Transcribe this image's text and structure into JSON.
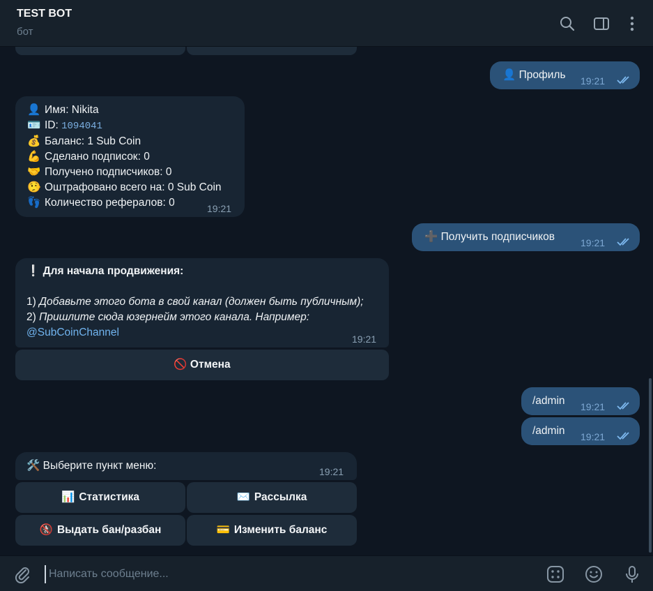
{
  "header": {
    "title": "TEST BOT",
    "subtitle": "бот"
  },
  "messages": {
    "profile_out": {
      "text": "👤 Профиль",
      "time": "19:21"
    },
    "profile_in": {
      "lines": [
        {
          "emoji": "👤",
          "text": "Имя: Nikita"
        },
        {
          "emoji": "🪪",
          "text": "ID: ",
          "mono": "1094041"
        },
        {
          "emoji": "💰",
          "text": "Баланс: 1 Sub Coin"
        },
        {
          "emoji": "💪",
          "text": "Сделано подписок: 0"
        },
        {
          "emoji": "🤝",
          "text": "Получено подписчиков: 0"
        },
        {
          "emoji": "🤥",
          "text": "Оштрафовано всего на: 0 Sub Coin"
        },
        {
          "emoji": "👣",
          "text": "Количество рефералов: 0"
        }
      ],
      "time": "19:21"
    },
    "get_subs_out": {
      "text": "➕ Получить подписчиков",
      "time": "19:21"
    },
    "promo_in": {
      "heading": "❕ Для начала продвижения:",
      "step1_num": "1) ",
      "step1": "Добавьте этого бота в свой канал (должен быть публичным);",
      "step2_num": "2) ",
      "step2": "Пришлите сюда юзернейм этого канала. Например:",
      "link": "@SubCoinChannel",
      "time": "19:21",
      "cancel_button": "🚫 Отмена"
    },
    "admin_out_1": {
      "text": "/admin",
      "time": "19:21"
    },
    "admin_out_2": {
      "text": "/admin",
      "time": "19:21"
    },
    "menu_in": {
      "text": "🛠️ Выберите пункт меню:",
      "time": "19:21",
      "buttons": [
        {
          "icon": "📊",
          "label": "Статистика"
        },
        {
          "icon": "✉️",
          "label": "Рассылка"
        },
        {
          "icon": "🚷",
          "label": "Выдать бан/разбан"
        },
        {
          "icon": "💳",
          "label": "Изменить баланс"
        }
      ]
    }
  },
  "composer": {
    "placeholder": "Написать сообщение..."
  },
  "colors": {
    "background": "#0e1621",
    "header": "#17212b",
    "incoming": "#182533",
    "outgoing": "#2b5278",
    "link": "#71b4ef"
  }
}
